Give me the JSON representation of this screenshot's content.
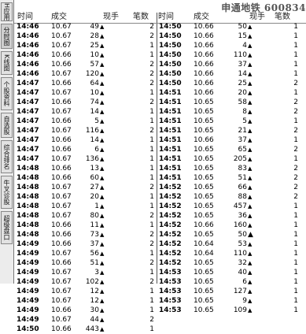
{
  "title": "申通地铁 600834",
  "sidebar": {
    "items": [
      {
        "label": "H应用",
        "name": "sidebar-item-apps"
      },
      {
        "label": "分时图",
        "name": "sidebar-item-timeshare"
      },
      {
        "label": "K线图",
        "name": "sidebar-item-kline"
      },
      {
        "label": "个股资料",
        "name": "sidebar-item-stock-info"
      },
      {
        "label": "自选股",
        "name": "sidebar-item-watchlist"
      },
      {
        "label": "综合排名",
        "name": "sidebar-item-ranking"
      },
      {
        "label": "牛叉诊股",
        "name": "sidebar-item-diagnosis"
      },
      {
        "label": "超级盘口",
        "name": "sidebar-item-super-quote"
      }
    ]
  },
  "columns": [
    "时间",
    "成交",
    "现手",
    "笔数"
  ],
  "left_rows": [
    {
      "time": "14:46",
      "price": "10.67",
      "vol": "49",
      "dir": "up",
      "cnt": "2"
    },
    {
      "time": "14:46",
      "price": "10.67",
      "vol": "28",
      "dir": "up",
      "cnt": "2"
    },
    {
      "time": "14:46",
      "price": "10.67",
      "vol": "25",
      "dir": "up",
      "cnt": "1"
    },
    {
      "time": "14:46",
      "price": "10.66",
      "vol": "10",
      "dir": "up",
      "cnt": "1"
    },
    {
      "time": "14:46",
      "price": "10.66",
      "vol": "57",
      "dir": "up",
      "cnt": "2"
    },
    {
      "time": "14:46",
      "price": "10.67",
      "vol": "120",
      "dir": "up",
      "cnt": "2"
    },
    {
      "time": "14:47",
      "price": "10.66",
      "vol": "64",
      "dir": "up",
      "cnt": "2"
    },
    {
      "time": "14:47",
      "price": "10.67",
      "vol": "10",
      "dir": "up",
      "cnt": "1"
    },
    {
      "time": "14:47",
      "price": "10.66",
      "vol": "74",
      "dir": "up",
      "cnt": "2"
    },
    {
      "time": "14:47",
      "price": "10.67",
      "vol": "14",
      "dir": "up",
      "cnt": "1"
    },
    {
      "time": "14:47",
      "price": "10.66",
      "vol": "5",
      "dir": "up",
      "cnt": "1"
    },
    {
      "time": "14:47",
      "price": "10.67",
      "vol": "116",
      "dir": "up",
      "cnt": "2"
    },
    {
      "time": "14:47",
      "price": "10.66",
      "vol": "14",
      "dir": "up",
      "cnt": "1"
    },
    {
      "time": "14:47",
      "price": "10.66",
      "vol": "6",
      "dir": "up",
      "cnt": "1"
    },
    {
      "time": "14:47",
      "price": "10.67",
      "vol": "136",
      "dir": "up",
      "cnt": "1"
    },
    {
      "time": "14:48",
      "price": "10.66",
      "vol": "13",
      "dir": "up",
      "cnt": "1"
    },
    {
      "time": "14:48",
      "price": "10.66",
      "vol": "60",
      "dir": "up",
      "cnt": "1"
    },
    {
      "time": "14:48",
      "price": "10.67",
      "vol": "27",
      "dir": "up",
      "cnt": "2"
    },
    {
      "time": "14:48",
      "price": "10.67",
      "vol": "20",
      "dir": "up",
      "cnt": "1"
    },
    {
      "time": "14:48",
      "price": "10.67",
      "vol": "1",
      "dir": "up",
      "cnt": "1"
    },
    {
      "time": "14:48",
      "price": "10.67",
      "vol": "80",
      "dir": "up",
      "cnt": "2"
    },
    {
      "time": "14:48",
      "price": "10.66",
      "vol": "11",
      "dir": "up",
      "cnt": "1"
    },
    {
      "time": "14:48",
      "price": "10.66",
      "vol": "73",
      "dir": "up",
      "cnt": "2"
    },
    {
      "time": "14:49",
      "price": "10.66",
      "vol": "37",
      "dir": "up",
      "cnt": "2"
    },
    {
      "time": "14:49",
      "price": "10.67",
      "vol": "56",
      "dir": "up",
      "cnt": "1"
    },
    {
      "time": "14:49",
      "price": "10.66",
      "vol": "51",
      "dir": "up",
      "cnt": "2"
    },
    {
      "time": "14:49",
      "price": "10.67",
      "vol": "3",
      "dir": "up",
      "cnt": "1"
    },
    {
      "time": "14:49",
      "price": "10.67",
      "vol": "102",
      "dir": "up",
      "cnt": "2"
    },
    {
      "time": "14:49",
      "price": "10.67",
      "vol": "12",
      "dir": "up",
      "cnt": "1"
    },
    {
      "time": "14:49",
      "price": "10.67",
      "vol": "12",
      "dir": "up",
      "cnt": "1"
    },
    {
      "time": "14:49",
      "price": "10.66",
      "vol": "30",
      "dir": "up",
      "cnt": "1"
    },
    {
      "time": "14:49",
      "price": "10.67",
      "vol": "44",
      "dir": "up",
      "cnt": "2"
    },
    {
      "time": "14:50",
      "price": "10.66",
      "vol": "443",
      "dir": "up",
      "cnt": "1"
    }
  ],
  "right_rows": [
    {
      "time": "14:50",
      "price": "10.66",
      "vol": "50",
      "dir": "up",
      "cnt": "1"
    },
    {
      "time": "14:50",
      "price": "10.66",
      "vol": "15",
      "dir": "up",
      "cnt": "1"
    },
    {
      "time": "14:50",
      "price": "10.66",
      "vol": "4",
      "dir": "up",
      "cnt": "1"
    },
    {
      "time": "14:50",
      "price": "10.66",
      "vol": "110",
      "dir": "up",
      "cnt": "1"
    },
    {
      "time": "14:50",
      "price": "10.66",
      "vol": "37",
      "dir": "up",
      "cnt": "1"
    },
    {
      "time": "14:50",
      "price": "10.66",
      "vol": "14",
      "dir": "up",
      "cnt": "1"
    },
    {
      "time": "14:50",
      "price": "10.66",
      "vol": "25",
      "dir": "up",
      "cnt": "2"
    },
    {
      "time": "14:51",
      "price": "10.66",
      "vol": "20",
      "dir": "up",
      "cnt": "1"
    },
    {
      "time": "14:51",
      "price": "10.65",
      "vol": "58",
      "dir": "up",
      "cnt": "2"
    },
    {
      "time": "14:51",
      "price": "10.65",
      "vol": "8",
      "dir": "up",
      "cnt": "2"
    },
    {
      "time": "14:51",
      "price": "10.65",
      "vol": "5",
      "dir": "up",
      "cnt": "1"
    },
    {
      "time": "14:51",
      "price": "10.65",
      "vol": "21",
      "dir": "up",
      "cnt": "2"
    },
    {
      "time": "14:51",
      "price": "10.66",
      "vol": "37",
      "dir": "up",
      "cnt": "1"
    },
    {
      "time": "14:51",
      "price": "10.65",
      "vol": "65",
      "dir": "up",
      "cnt": "2"
    },
    {
      "time": "14:51",
      "price": "10.65",
      "vol": "205",
      "dir": "up",
      "cnt": "1"
    },
    {
      "time": "14:51",
      "price": "10.65",
      "vol": "83",
      "dir": "up",
      "cnt": "2"
    },
    {
      "time": "14:51",
      "price": "10.65",
      "vol": "51",
      "dir": "up",
      "cnt": "2"
    },
    {
      "time": "14:52",
      "price": "10.65",
      "vol": "66",
      "dir": "up",
      "cnt": "2"
    },
    {
      "time": "14:52",
      "price": "10.65",
      "vol": "88",
      "dir": "up",
      "cnt": "2"
    },
    {
      "time": "14:52",
      "price": "10.65",
      "vol": "457",
      "dir": "up",
      "cnt": "1"
    },
    {
      "time": "14:52",
      "price": "10.65",
      "vol": "36",
      "dir": "up",
      "cnt": "1"
    },
    {
      "time": "14:52",
      "price": "10.66",
      "vol": "160",
      "dir": "up",
      "cnt": "1"
    },
    {
      "time": "14:52",
      "price": "10.65",
      "vol": "50",
      "dir": "up-bold",
      "cnt": "1"
    },
    {
      "time": "14:52",
      "price": "10.64",
      "vol": "53",
      "dir": "up",
      "cnt": "1"
    },
    {
      "time": "14:52",
      "price": "10.64",
      "vol": "110",
      "dir": "up",
      "cnt": "1"
    },
    {
      "time": "14:52",
      "price": "10.65",
      "vol": "32",
      "dir": "up",
      "cnt": "1"
    },
    {
      "time": "14:53",
      "price": "10.65",
      "vol": "40",
      "dir": "up",
      "cnt": "1"
    },
    {
      "time": "14:53",
      "price": "10.65",
      "vol": "6",
      "dir": "up",
      "cnt": "1"
    },
    {
      "time": "14:53",
      "price": "10.65",
      "vol": "127",
      "dir": "up",
      "cnt": "1"
    },
    {
      "time": "14:53",
      "price": "10.65",
      "vol": "9",
      "dir": "up",
      "cnt": "1"
    },
    {
      "time": "14:53",
      "price": "10.65",
      "vol": "109",
      "dir": "up",
      "cnt": "1"
    }
  ]
}
